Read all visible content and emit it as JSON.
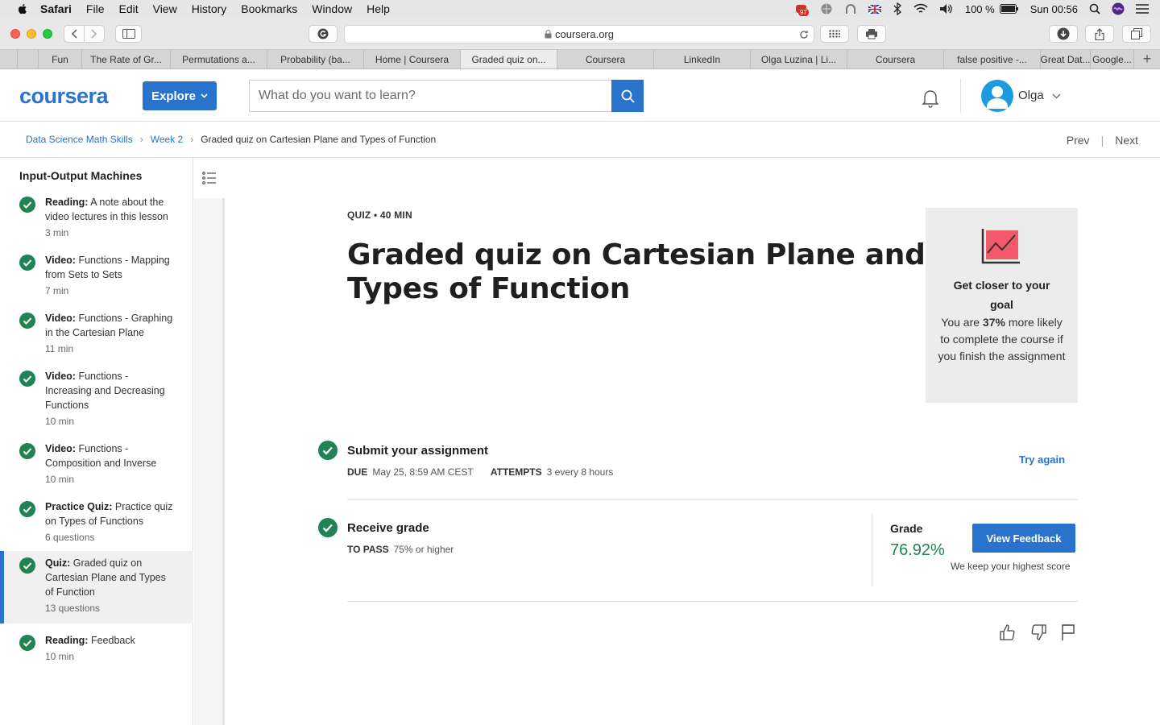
{
  "menubar": {
    "app": "Safari",
    "items": [
      "File",
      "Edit",
      "View",
      "History",
      "Bookmarks",
      "Window",
      "Help"
    ],
    "battery": "100 %",
    "clock": "Sun 00:56",
    "badge": "97"
  },
  "browser": {
    "url": "coursera.org",
    "tabs": [
      {
        "label": "Fun",
        "active": false
      },
      {
        "label": "The Rate of Gr...",
        "active": false
      },
      {
        "label": "Permutations a...",
        "active": false
      },
      {
        "label": "Probability (ba...",
        "active": false
      },
      {
        "label": "Home | Coursera",
        "active": false
      },
      {
        "label": "Graded quiz on...",
        "active": true
      },
      {
        "label": "Coursera",
        "active": false
      },
      {
        "label": "LinkedIn",
        "active": false
      },
      {
        "label": "Olga Luzina | Li...",
        "active": false
      },
      {
        "label": "Coursera",
        "active": false
      },
      {
        "label": "false positive -...",
        "active": false
      },
      {
        "label": "Great Dat...",
        "active": false
      },
      {
        "label": "Google...",
        "active": false
      }
    ]
  },
  "header": {
    "logo": "coursera",
    "explore": "Explore",
    "search_placeholder": "What do you want to learn?",
    "user": "Olga",
    "brand_color": "#2a73cc"
  },
  "breadcrumb": {
    "items": [
      "Data Science Math Skills",
      "Week 2"
    ],
    "current": "Graded quiz on Cartesian Plane and Types of Function",
    "prev": "Prev",
    "next": "Next"
  },
  "sidebar": {
    "title": "Input-Output Machines",
    "items": [
      {
        "type": "Reading:",
        "title": "A note about the video lectures in this lesson",
        "meta": "3 min",
        "active": false
      },
      {
        "type": "Video:",
        "title": "Functions - Mapping from Sets to Sets",
        "meta": "7 min",
        "active": false
      },
      {
        "type": "Video:",
        "title": "Functions - Graphing in the Cartesian Plane",
        "meta": "11 min",
        "active": false
      },
      {
        "type": "Video:",
        "title": "Functions - Increasing and Decreasing Functions",
        "meta": "10 min",
        "active": false
      },
      {
        "type": "Video:",
        "title": "Functions - Composition and Inverse",
        "meta": "10 min",
        "active": false
      },
      {
        "type": "Practice Quiz:",
        "title": "Practice quiz on Types of Functions",
        "meta": "6 questions",
        "active": false
      },
      {
        "type": "Quiz:",
        "title": "Graded quiz on Cartesian Plane and Types of Function",
        "meta": "13 questions",
        "active": true
      },
      {
        "type": "Reading:",
        "title": "Feedback",
        "meta": "10 min",
        "active": false
      }
    ]
  },
  "quiz": {
    "meta": "QUIZ • 40 MIN",
    "title": "Graded quiz on Cartesian Plane and Types of Function"
  },
  "goal_card": {
    "title": "Get closer to your goal",
    "body_pre": "You are ",
    "percent": "37%",
    "body_post": " more likely to complete the course if you finish the assignment"
  },
  "submit": {
    "heading": "Submit your assignment",
    "due_label": "DUE",
    "due_value": "May 25, 8:59 AM CEST",
    "attempts_label": "ATTEMPTS",
    "attempts_value": "3 every 8 hours",
    "try_again": "Try again"
  },
  "receive": {
    "heading": "Receive grade",
    "pass_label": "TO PASS",
    "pass_value": "75% or higher",
    "grade_label": "Grade",
    "grade_value": "76.92%",
    "view_feedback": "View Feedback",
    "keep_note": "We keep your highest score"
  },
  "colors": {
    "accent": "#2a73cc",
    "success": "#1f8354"
  }
}
